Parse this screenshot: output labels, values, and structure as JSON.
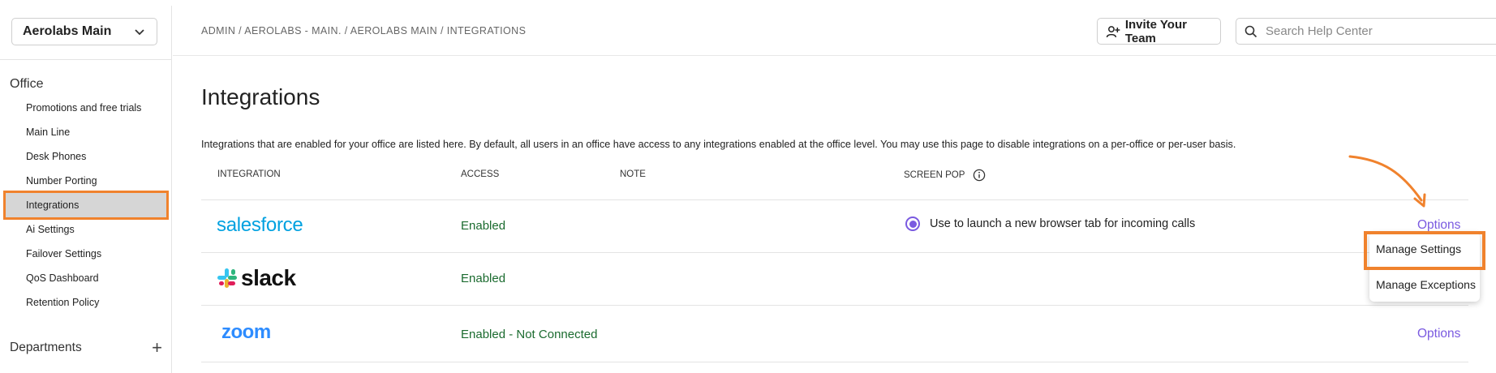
{
  "sidebar": {
    "office_select": "Aerolabs Main",
    "section_title": "Office",
    "items": [
      {
        "label": "Promotions and free trials"
      },
      {
        "label": "Main Line"
      },
      {
        "label": "Desk Phones"
      },
      {
        "label": "Number Porting"
      },
      {
        "label": "Integrations",
        "active": true
      },
      {
        "label": "Ai Settings"
      },
      {
        "label": "Failover Settings"
      },
      {
        "label": "QoS Dashboard"
      },
      {
        "label": "Retention Policy"
      }
    ],
    "departments_label": "Departments"
  },
  "header": {
    "breadcrumb": [
      "ADMIN",
      "AEROLABS - MAIN.",
      "AEROLABS MAIN",
      "INTEGRATIONS"
    ],
    "breadcrumb_sep": " / ",
    "invite_label": "Invite Your Team",
    "search_placeholder": "Search Help Center"
  },
  "main": {
    "title": "Integrations",
    "description": "Integrations that are enabled for your office are listed here. By default, all users in an office have access to any integrations enabled at the office level. You may use this page to disable integrations on a per-office or per-user basis.",
    "columns": {
      "integration": "INTEGRATION",
      "access": "ACCESS",
      "note": "NOTE",
      "screen_pop": "SCREEN POP"
    },
    "rows": [
      {
        "logo": "salesforce",
        "access": "Enabled",
        "screen_pop": "Use to launch a new browser tab for incoming calls",
        "options": "Options"
      },
      {
        "logo": "slack",
        "access": "Enabled"
      },
      {
        "logo": "zoom",
        "access": "Enabled - Not Connected",
        "options": "Options"
      }
    ]
  },
  "menu": {
    "items": [
      "Manage Settings",
      "Manage Exceptions"
    ]
  },
  "colors": {
    "accent": "#7a5ae0",
    "highlight": "#f0822d",
    "enabled_text": "#1b6b2f",
    "salesforce": "#00a1e0",
    "zoom": "#2d8cff"
  }
}
